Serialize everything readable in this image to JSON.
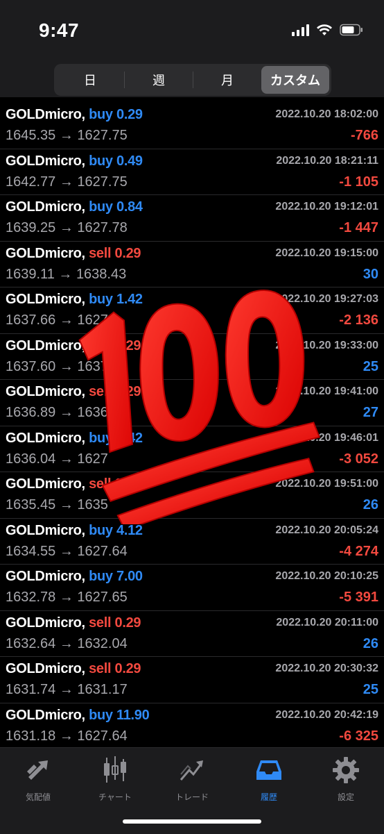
{
  "status": {
    "time": "9:47"
  },
  "segments": [
    {
      "label": "日",
      "active": false
    },
    {
      "label": "週",
      "active": false
    },
    {
      "label": "月",
      "active": false
    },
    {
      "label": "カスタム",
      "active": true
    }
  ],
  "trades": [
    {
      "symbol": "GOLDmicro,",
      "side": "buy",
      "volume": "0.29",
      "open": "1645.35",
      "close": "1627.75",
      "datetime": "2022.10.20 18:02:00",
      "profit": "-766"
    },
    {
      "symbol": "GOLDmicro,",
      "side": "buy",
      "volume": "0.49",
      "open": "1642.77",
      "close": "1627.75",
      "datetime": "2022.10.20 18:21:11",
      "profit": "-1 105"
    },
    {
      "symbol": "GOLDmicro,",
      "side": "buy",
      "volume": "0.84",
      "open": "1639.25",
      "close": "1627.78",
      "datetime": "2022.10.20 19:12:01",
      "profit": "-1 447"
    },
    {
      "symbol": "GOLDmicro,",
      "side": "sell",
      "volume": "0.29",
      "open": "1639.11",
      "close": "1638.43",
      "datetime": "2022.10.20 19:15:00",
      "profit": "30"
    },
    {
      "symbol": "GOLDmicro,",
      "side": "buy",
      "volume": "1.42",
      "open": "1637.66",
      "close": "1627.6",
      "datetime": "2022.10.20 19:27:03",
      "profit": "-2 136"
    },
    {
      "symbol": "GOLDmicro,",
      "side": "sell",
      "volume": "0.29",
      "open": "1637.60",
      "close": "1637",
      "datetime": "2022.10.20 19:33:00",
      "profit": "25"
    },
    {
      "symbol": "GOLDmicro,",
      "side": "sell",
      "volume": "0.29",
      "open": "1636.89",
      "close": "1636.2",
      "datetime": "2022.10.20 19:41:00",
      "profit": "27"
    },
    {
      "symbol": "GOLDmicro,",
      "side": "buy",
      "volume": "2.42",
      "open": "1636.04",
      "close": "1627",
      "datetime": "2022.10.20 19:46:01",
      "profit": "-3 052"
    },
    {
      "symbol": "GOLDmicro,",
      "side": "sell",
      "volume": "0.29",
      "open": "1635.45",
      "close": "1635",
      "datetime": "2022.10.20 19:51:00",
      "profit": "26"
    },
    {
      "symbol": "GOLDmicro,",
      "side": "buy",
      "volume": "4.12",
      "open": "1634.55",
      "close": "1627.64",
      "datetime": "2022.10.20 20:05:24",
      "profit": "-4 274"
    },
    {
      "symbol": "GOLDmicro,",
      "side": "buy",
      "volume": "7.00",
      "open": "1632.78",
      "close": "1627.65",
      "datetime": "2022.10.20 20:10:25",
      "profit": "-5 391"
    },
    {
      "symbol": "GOLDmicro,",
      "side": "sell",
      "volume": "0.29",
      "open": "1632.64",
      "close": "1632.04",
      "datetime": "2022.10.20 20:11:00",
      "profit": "26"
    },
    {
      "symbol": "GOLDmicro,",
      "side": "sell",
      "volume": "0.29",
      "open": "1631.74",
      "close": "1631.17",
      "datetime": "2022.10.20 20:30:32",
      "profit": "25"
    },
    {
      "symbol": "GOLDmicro,",
      "side": "buy",
      "volume": "11.90",
      "open": "1631.18",
      "close": "1627.64",
      "datetime": "2022.10.20 20:42:19",
      "profit": "-6 325"
    }
  ],
  "arrow": "→",
  "tabs": [
    {
      "label": "気配値",
      "icon": "quotes-icon",
      "active": false
    },
    {
      "label": "チャート",
      "icon": "chart-icon",
      "active": false
    },
    {
      "label": "トレード",
      "icon": "trade-icon",
      "active": false
    },
    {
      "label": "履歴",
      "icon": "history-icon",
      "active": true
    },
    {
      "label": "設定",
      "icon": "settings-icon",
      "active": false
    }
  ],
  "overlay": {
    "icon": "hundred-points-emoji",
    "text": "100"
  },
  "colors": {
    "buy": "#2f8af5",
    "sell": "#f2493f",
    "accent": "#2f8af5"
  }
}
